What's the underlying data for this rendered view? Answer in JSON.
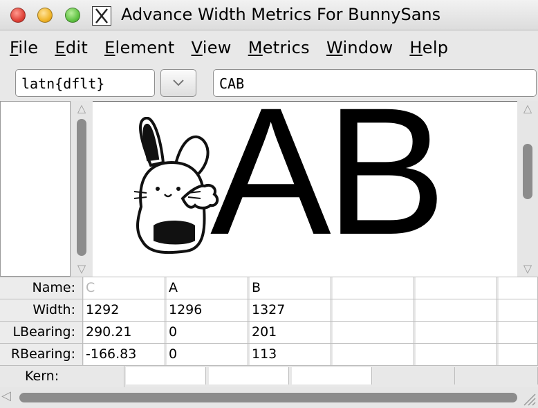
{
  "window": {
    "title": "Advance Width Metrics For BunnySans"
  },
  "menu": [
    {
      "label": "File",
      "u": "F",
      "rest": "ile"
    },
    {
      "label": "Edit",
      "u": "E",
      "rest": "dit"
    },
    {
      "label": "Element",
      "u": "E",
      "rest": "lement"
    },
    {
      "label": "View",
      "u": "V",
      "rest": "iew"
    },
    {
      "label": "Metrics",
      "u": "M",
      "rest": "etrics"
    },
    {
      "label": "Window",
      "u": "W",
      "rest": "indow"
    },
    {
      "label": "Help",
      "u": "H",
      "rest": "elp"
    }
  ],
  "toolbar": {
    "script_value": "latn{dflt}",
    "text_value": "CAB"
  },
  "preview": {
    "glyphs": "AB"
  },
  "table": {
    "labels": {
      "name": "Name:",
      "width": "Width:",
      "lbearing": "LBearing:",
      "rbearing": "RBearing:",
      "kern": "Kern:"
    },
    "columns": [
      {
        "name": "C",
        "width": "1292",
        "lbearing": "290.21",
        "rbearing": "-166.83"
      },
      {
        "name": "A",
        "width": "1296",
        "lbearing": "0",
        "rbearing": "0"
      },
      {
        "name": "B",
        "width": "1327",
        "lbearing": "201",
        "rbearing": "113"
      }
    ]
  },
  "icons": [
    "close-button",
    "minimize-button",
    "maximize-button",
    "x-app-icon",
    "chevron-down-icon",
    "arrow-up-icon",
    "arrow-down-icon",
    "arrow-left-icon",
    "resize-grip-icon"
  ]
}
